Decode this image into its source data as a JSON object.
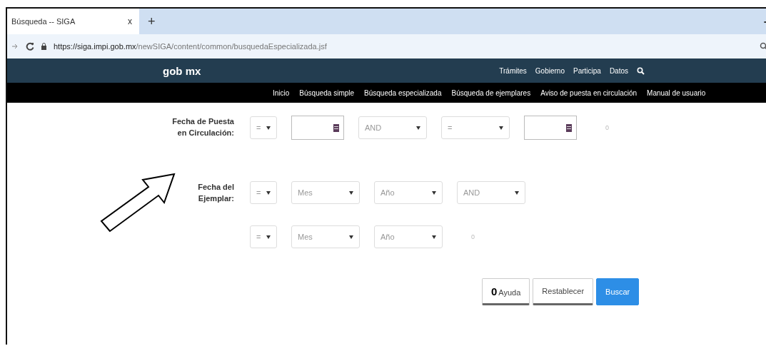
{
  "browser": {
    "tab_title": "Búsqueda -- SIGA",
    "tab_close": "x",
    "new_tab": "+",
    "minimize": "-",
    "url_bold": "https://siga.impi.gob.mx",
    "url_rest": "/newSIGA/content/common/busquedaEspecializada.jsf"
  },
  "header": {
    "logo": "gob mx",
    "links": [
      "Trámites",
      "Gobierno",
      "Participa",
      "Datos"
    ]
  },
  "nav": [
    "Inicio",
    "Búsqueda simple",
    "Búsqueda especializada",
    "Búsqueda de ejemplares",
    "Aviso de puesta en circulación",
    "Manual de usuario"
  ],
  "form": [
    {
      "label": "Fecha de Puesta en Circulación:",
      "controls": [
        {
          "kind": "operator",
          "value": "="
        },
        {
          "kind": "date"
        },
        {
          "kind": "select",
          "value": "AND"
        },
        {
          "kind": "select",
          "value": "="
        },
        {
          "kind": "date"
        },
        {
          "kind": "hint",
          "value": "0"
        }
      ]
    },
    {
      "label": "Fecha del Ejemplar:",
      "controls": [
        {
          "kind": "operator",
          "value": "="
        },
        {
          "kind": "select",
          "value": "Mes"
        },
        {
          "kind": "select",
          "value": "Año"
        },
        {
          "kind": "select",
          "value": "AND"
        }
      ]
    },
    {
      "controls": [
        {
          "kind": "operator",
          "value": "="
        },
        {
          "kind": "select",
          "value": "Mes"
        },
        {
          "kind": "select",
          "value": "Año"
        },
        {
          "kind": "hint",
          "value": "0"
        }
      ]
    }
  ],
  "buttons": [
    {
      "kind": "help",
      "icon_text": "0",
      "label": "Ayuda"
    },
    {
      "kind": "plain",
      "label": "Restablecer"
    },
    {
      "kind": "primary",
      "label": "Buscar"
    }
  ]
}
